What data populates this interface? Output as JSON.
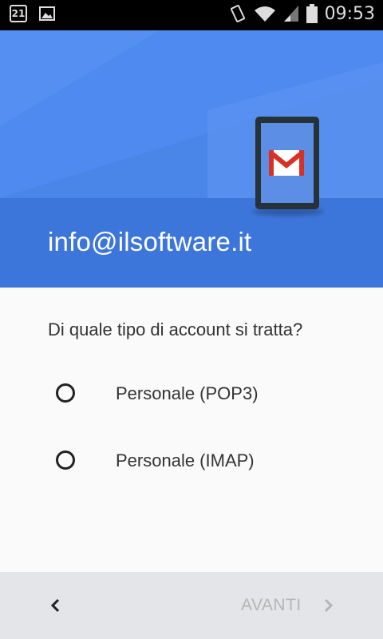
{
  "status_bar": {
    "time": "09:53",
    "calendar_day": "21",
    "icons": [
      "calendar-icon",
      "image-icon",
      "vibrate-icon",
      "wifi-icon",
      "signal-icon",
      "battery-icon"
    ]
  },
  "header": {
    "email": "info@ilsoftware.it",
    "illustration": "gmail-phone-icon",
    "colors": {
      "top": "#4a86e8",
      "bottom": "#3d76db"
    }
  },
  "main": {
    "question": "Di quale tipo di account si tratta?",
    "options": [
      {
        "label": "Personale (POP3)",
        "selected": false
      },
      {
        "label": "Personale (IMAP)",
        "selected": false
      }
    ]
  },
  "nav": {
    "back_icon": "chevron-left-icon",
    "next_label": "AVANTI",
    "next_icon": "chevron-right-icon",
    "next_enabled": false
  }
}
